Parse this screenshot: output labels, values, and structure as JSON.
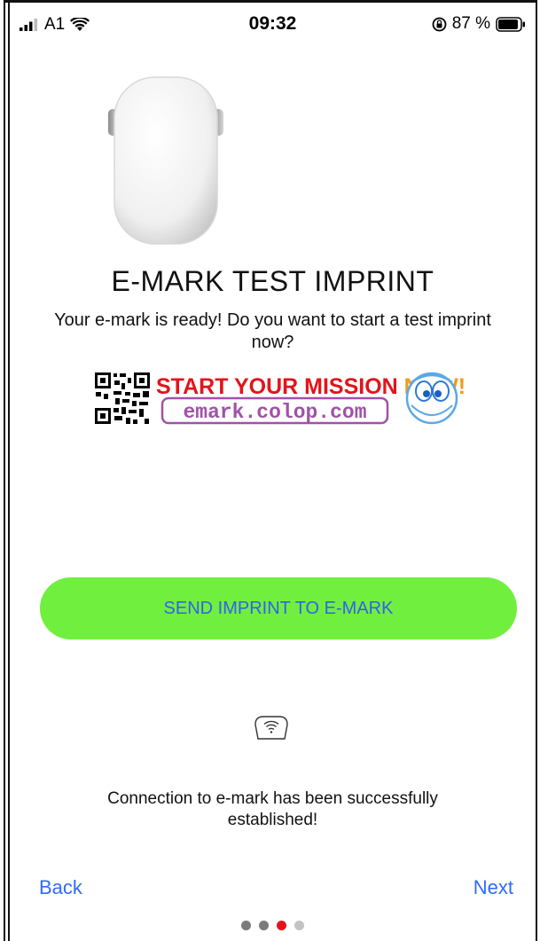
{
  "status_bar": {
    "carrier": "A1",
    "time": "09:32",
    "battery": "87 %"
  },
  "main": {
    "title": "E-MARK TEST IMPRINT",
    "subtitle": "Your e-mark is ready! Do you want to start a test imprint now?",
    "banner": {
      "headline_part1": "START YOUR MISSION ",
      "headline_part2": "NOW!",
      "url": "emark.colop.com"
    },
    "send_button_label": "SEND IMPRINT TO E-MARK",
    "connection_message": "Connection to e-mark has been successfully established!"
  },
  "footer": {
    "back_label": "Back",
    "next_label": "Next",
    "page_dots": [
      {
        "active": false,
        "color": "#7b7b7b"
      },
      {
        "active": false,
        "color": "#7b7b7b"
      },
      {
        "active": true,
        "color": "#e3141b"
      },
      {
        "active": false,
        "color": "#c3c3c3"
      }
    ]
  },
  "colors": {
    "accent_green": "#71ef3e",
    "link_blue": "#2f6bff",
    "button_text_blue": "#2f63ee",
    "active_dot": "#e3141b"
  },
  "icons": [
    "signal-icon",
    "wifi-icon",
    "rotation-lock-icon",
    "battery-icon",
    "emark-device-image",
    "qr-code-icon",
    "mascot-icon",
    "connection-icon"
  ]
}
